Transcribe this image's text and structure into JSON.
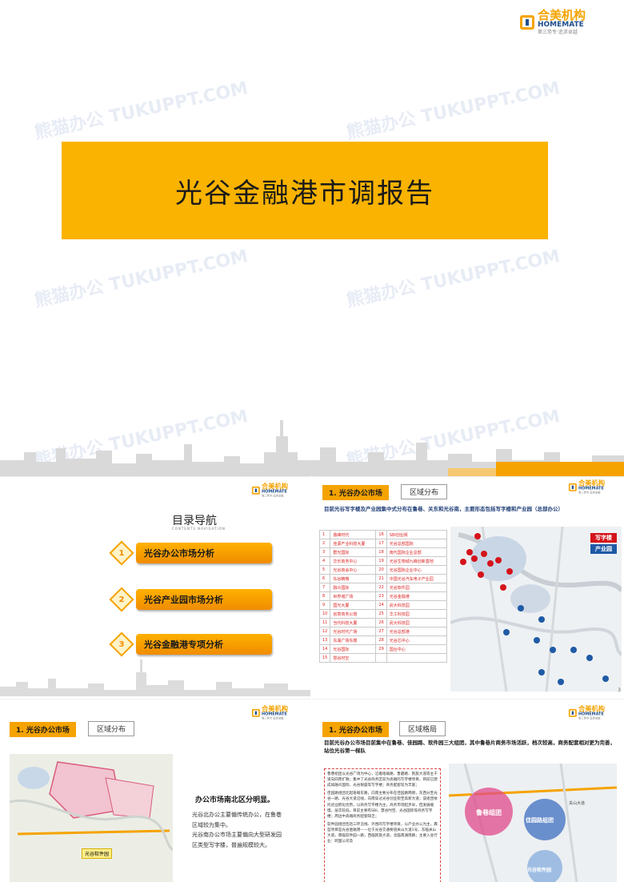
{
  "brand": {
    "name_cn": "合美机构",
    "name_en": "HOMEMATE",
    "slogan": "第三势专·追求卓越"
  },
  "watermark": "熊猫办公 TUKUPPT.COM",
  "cover": {
    "title": "光谷金融港市调报告",
    "accent": "#f9b300"
  },
  "toc": {
    "title": "目录导航",
    "subtitle": "CONTENTS NAVIGATION",
    "items": [
      {
        "num": "1",
        "label": "光谷办公市场分析"
      },
      {
        "num": "2",
        "label": "光谷产业园市场分析"
      },
      {
        "num": "3",
        "label": "光谷金融港专项分析"
      }
    ]
  },
  "slide3": {
    "tab": "1. 光谷办公市场",
    "sub": "区域分布",
    "desc": "目前光谷写字楼及产业园集中式分布在鲁巷、关东和光谷南，主要形态包括写字楼和产业园（总部办公）",
    "legend": [
      "写字楼",
      "产业园"
    ],
    "page": "3",
    "rows": [
      [
        "1",
        "鼎峰时代",
        "16",
        "SBI创业街"
      ],
      [
        "2",
        "佳源产业科技大厦",
        "17",
        "光谷总部国际"
      ],
      [
        "3",
        "群光国际",
        "18",
        "南代国际企业总部"
      ],
      [
        "4",
        "华乐商务中心",
        "19",
        "光谷生物城九峰创新基地"
      ],
      [
        "5",
        "光谷商会中心",
        "20",
        "光谷国际企业中心"
      ],
      [
        "6",
        "东谷精微",
        "21",
        "中国光谷汽车电子产业园"
      ],
      [
        "7",
        "融众国际",
        "22",
        "光谷软件园"
      ],
      [
        "8",
        "世界城广场",
        "23",
        "光谷金融港"
      ],
      [
        "9",
        "国光大厦",
        "24",
        "武大科技园"
      ],
      [
        "10",
        "创意商务公馆",
        "25",
        "华工科技园"
      ],
      [
        "11",
        "当代科技大厦",
        "26",
        "武大科技园"
      ],
      [
        "12",
        "光谷时代广场",
        "27",
        "光谷总部港"
      ],
      [
        "13",
        "东湖广场东楼",
        "28",
        "光谷芯中心"
      ],
      [
        "14",
        "光谷国际",
        "29",
        "国台中心"
      ],
      [
        "15",
        "慧谷时空",
        "",
        ""
      ]
    ]
  },
  "slide4": {
    "tab": "1. 光谷办公市场",
    "sub": "区域分布",
    "heading": "办公市场南北区分明显。",
    "lines": [
      "光谷北办公主要偏传统办公，在鲁巷",
      "区域较为集中。",
      "光谷南办公市场主要偏向大型研发园",
      "区类型写字楼，普遍规模较大。"
    ],
    "map_label": "光谷软件园"
  },
  "slide5": {
    "tab": "1. 光谷办公市场",
    "sub": "区域格局",
    "desc": "目前光谷办公市场目前集中在鲁巷、佳园路、软件园三大组团，其中鲁巷片商务市场活跃，档次较高，商务配套相对更为完善，站位光谷第一梯队",
    "bullets": [
      "鲁巷组团以光谷广场为中心，沿着珞瑜路、鲁磨路、民族大道等主干道向四周扩散；集中了光谷商务区较为高端的写字楼项目，目前已建成如融众国际、光谷银座等写字楼；商务配套较为丰富；",
      "佳园路组团北起珞喻东路，向南主要分布在佳园路两侧，东西分至光谷一路、光谷大道沿线，向南穿过光谷创业街至高新大道；该组团依托创业孵化优势，以商务写字楼为主，商务市场起步早，但发展缓慢，层次较低，目前主要有SBI、慧谷时空、光谷国际等商务写字楼；周边中高端商务配套缺乏；",
      "软件园组团包括三环沿线、外围的写字楼项目，以产业办公为主，典型项目是光谷金融港——位于光谷交通要道关山大道1号，东临关山大道，南临软件园一路，西临民族大道，北临南湖南路；主要入驻行业：跨国公司及"
    ],
    "map_labels": [
      "鲁巷组团",
      "佳园路组团",
      "光谷软件园",
      "关山大道"
    ]
  }
}
